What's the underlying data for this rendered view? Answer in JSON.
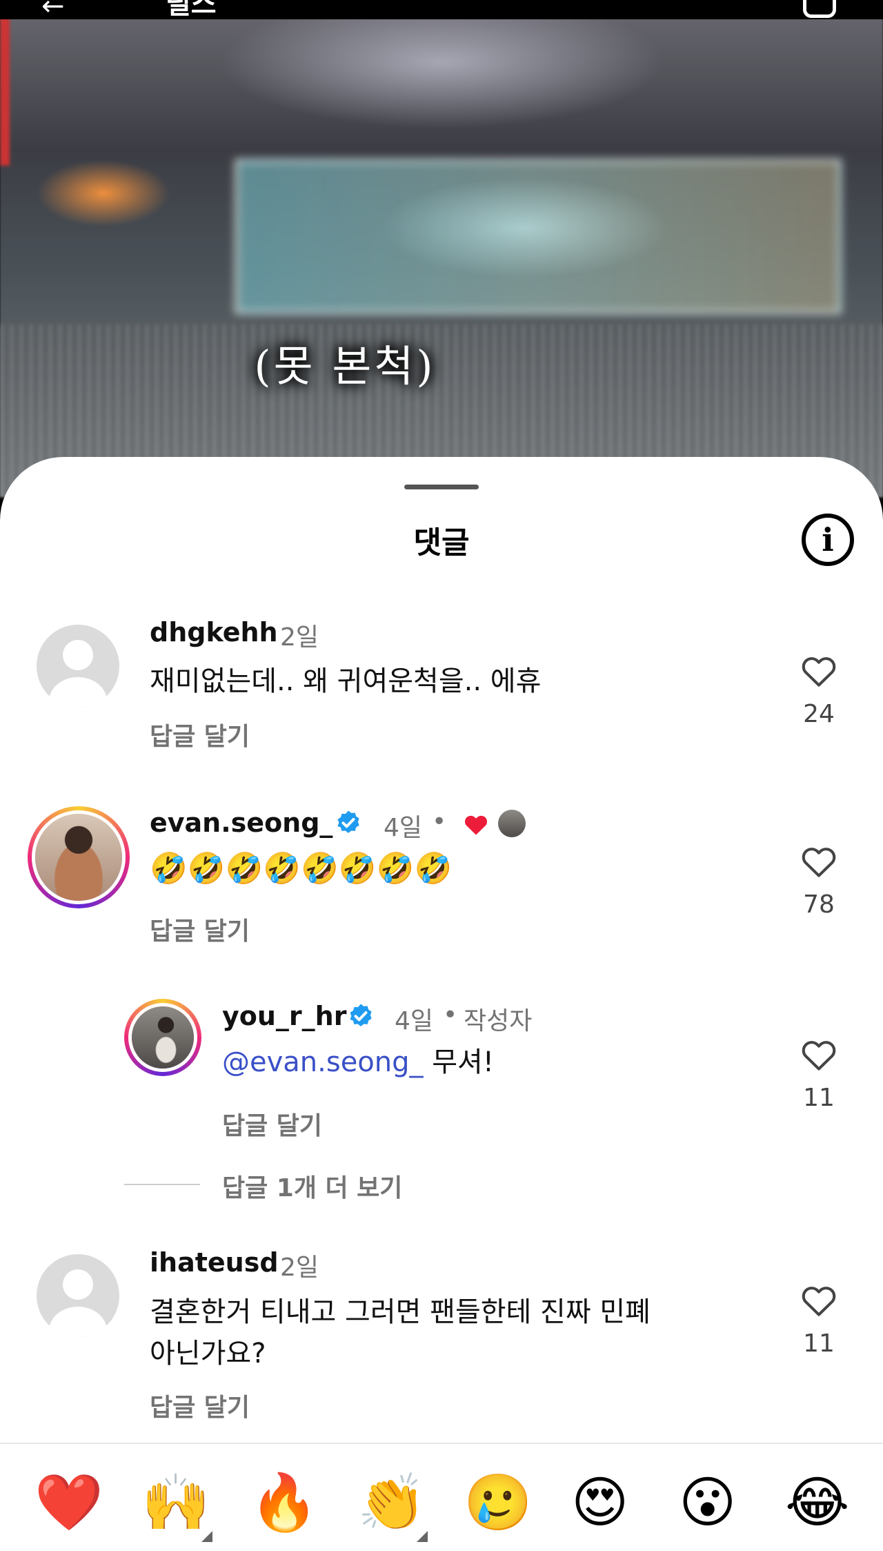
{
  "video": {
    "header_title": "릴스",
    "caption": "(못 본척)"
  },
  "sheet": {
    "title": "댓글"
  },
  "comments": [
    {
      "username": "dhgkehh",
      "time": "2일",
      "text": "재미없는데.. 왜 귀여운척을.. 에휴",
      "reply_label": "답글 달기",
      "likes": "24"
    },
    {
      "username": "evan.seong_",
      "time": "4일",
      "text": "🤣🤣🤣🤣🤣🤣🤣🤣",
      "reply_label": "답글 달기",
      "likes": "78"
    },
    {
      "username": "you_r_hr",
      "time": "4일",
      "author_label": "작성자",
      "mention": "@evan.seong_",
      "text": " 무셔!",
      "reply_label": "답글 달기",
      "likes": "11",
      "more_replies": "답글 1개 더 보기"
    },
    {
      "username": "ihateusd",
      "time": "2일",
      "text_line1": "결혼한거 티내고 그러면 팬들한테 진짜 민폐",
      "text_line2": "아닌가요?",
      "reply_label": "답글 달기",
      "likes": "11"
    }
  ],
  "reactions": [
    {
      "icon": "red-heart",
      "glyph": "❤️"
    },
    {
      "icon": "raising-hands",
      "glyph": "🙌"
    },
    {
      "icon": "fire",
      "glyph": "🔥"
    },
    {
      "icon": "clapping-hands",
      "glyph": "👏"
    },
    {
      "icon": "crying-face",
      "glyph": "🥲"
    },
    {
      "icon": "heart-eyes",
      "glyph": "😍"
    },
    {
      "icon": "surprised-face",
      "glyph": "😮"
    },
    {
      "icon": "tears-of-joy",
      "glyph": "😂"
    }
  ]
}
